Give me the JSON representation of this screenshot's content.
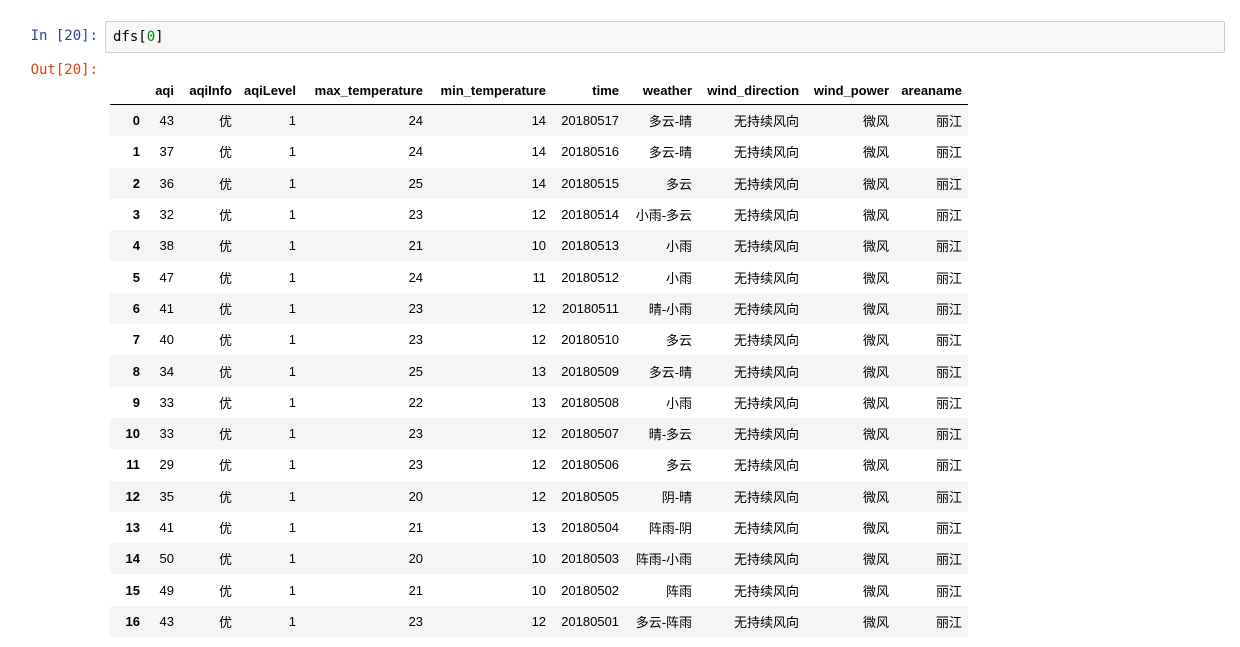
{
  "notebook": {
    "in_prompt": "In [20]:",
    "out_prompt": "Out[20]:",
    "code_prefix": "dfs[",
    "code_index": "0",
    "code_suffix": "]"
  },
  "dataframe": {
    "columns": [
      "",
      "aqi",
      "aqiInfo",
      "aqiLevel",
      "max_temperature",
      "min_temperature",
      "time",
      "weather",
      "wind_direction",
      "wind_power",
      "areaname"
    ],
    "rows": [
      [
        "0",
        "43",
        "优",
        "1",
        "24",
        "14",
        "20180517",
        "多云-晴",
        "无持续风向",
        "微风",
        "丽江"
      ],
      [
        "1",
        "37",
        "优",
        "1",
        "24",
        "14",
        "20180516",
        "多云-晴",
        "无持续风向",
        "微风",
        "丽江"
      ],
      [
        "2",
        "36",
        "优",
        "1",
        "25",
        "14",
        "20180515",
        "多云",
        "无持续风向",
        "微风",
        "丽江"
      ],
      [
        "3",
        "32",
        "优",
        "1",
        "23",
        "12",
        "20180514",
        "小雨-多云",
        "无持续风向",
        "微风",
        "丽江"
      ],
      [
        "4",
        "38",
        "优",
        "1",
        "21",
        "10",
        "20180513",
        "小雨",
        "无持续风向",
        "微风",
        "丽江"
      ],
      [
        "5",
        "47",
        "优",
        "1",
        "24",
        "11",
        "20180512",
        "小雨",
        "无持续风向",
        "微风",
        "丽江"
      ],
      [
        "6",
        "41",
        "优",
        "1",
        "23",
        "12",
        "20180511",
        "晴-小雨",
        "无持续风向",
        "微风",
        "丽江"
      ],
      [
        "7",
        "40",
        "优",
        "1",
        "23",
        "12",
        "20180510",
        "多云",
        "无持续风向",
        "微风",
        "丽江"
      ],
      [
        "8",
        "34",
        "优",
        "1",
        "25",
        "13",
        "20180509",
        "多云-晴",
        "无持续风向",
        "微风",
        "丽江"
      ],
      [
        "9",
        "33",
        "优",
        "1",
        "22",
        "13",
        "20180508",
        "小雨",
        "无持续风向",
        "微风",
        "丽江"
      ],
      [
        "10",
        "33",
        "优",
        "1",
        "23",
        "12",
        "20180507",
        "晴-多云",
        "无持续风向",
        "微风",
        "丽江"
      ],
      [
        "11",
        "29",
        "优",
        "1",
        "23",
        "12",
        "20180506",
        "多云",
        "无持续风向",
        "微风",
        "丽江"
      ],
      [
        "12",
        "35",
        "优",
        "1",
        "20",
        "12",
        "20180505",
        "阴-晴",
        "无持续风向",
        "微风",
        "丽江"
      ],
      [
        "13",
        "41",
        "优",
        "1",
        "21",
        "13",
        "20180504",
        "阵雨-阴",
        "无持续风向",
        "微风",
        "丽江"
      ],
      [
        "14",
        "50",
        "优",
        "1",
        "20",
        "10",
        "20180503",
        "阵雨-小雨",
        "无持续风向",
        "微风",
        "丽江"
      ],
      [
        "15",
        "49",
        "优",
        "1",
        "21",
        "10",
        "20180502",
        "阵雨",
        "无持续风向",
        "微风",
        "丽江"
      ],
      [
        "16",
        "43",
        "优",
        "1",
        "23",
        "12",
        "20180501",
        "多云-阵雨",
        "无持续风向",
        "微风",
        "丽江"
      ]
    ]
  },
  "colors": {
    "in_prompt": "#303f9f",
    "out_prompt": "#d84315",
    "code_number": "#008800",
    "stripe": "#f5f5f5"
  }
}
